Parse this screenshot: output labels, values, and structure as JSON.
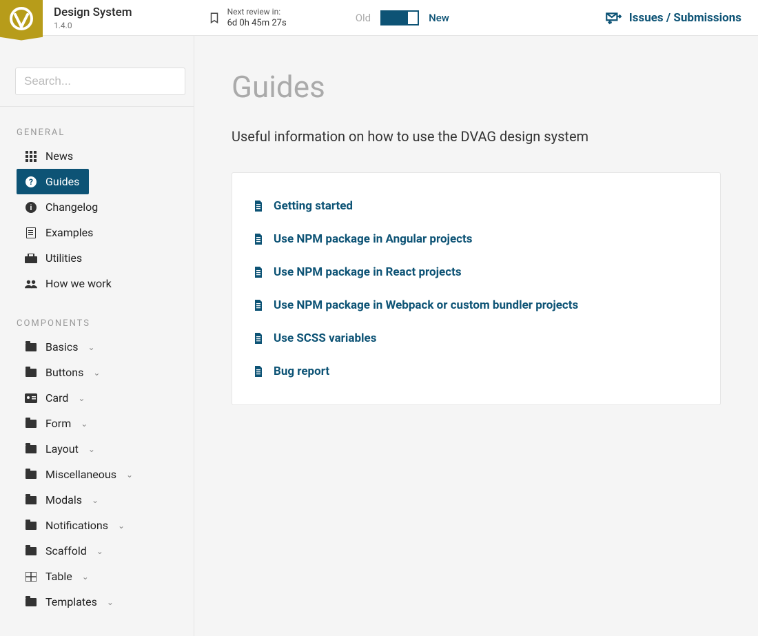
{
  "header": {
    "brand_title": "Design System",
    "brand_version": "1.4.0",
    "review_label": "Next review in:",
    "review_value": "6d   0h   45m   27s",
    "switch_old": "Old",
    "switch_new": "New",
    "issues_label": "Issues / Submissions"
  },
  "search": {
    "placeholder": "Search..."
  },
  "sidebar": {
    "section_general": "GENERAL",
    "section_components": "COMPONENTS",
    "general": [
      {
        "label": "News",
        "icon": "grid"
      },
      {
        "label": "Guides",
        "icon": "question",
        "active": true
      },
      {
        "label": "Changelog",
        "icon": "info"
      },
      {
        "label": "Examples",
        "icon": "doc"
      },
      {
        "label": "Utilities",
        "icon": "tools"
      },
      {
        "label": "How we work",
        "icon": "users"
      }
    ],
    "components": [
      {
        "label": "Basics"
      },
      {
        "label": "Buttons"
      },
      {
        "label": "Card"
      },
      {
        "label": "Form"
      },
      {
        "label": "Layout"
      },
      {
        "label": "Miscellaneous"
      },
      {
        "label": "Modals"
      },
      {
        "label": "Notifications"
      },
      {
        "label": "Scaffold"
      },
      {
        "label": "Table"
      },
      {
        "label": "Templates"
      }
    ]
  },
  "page": {
    "title": "Guides",
    "subtitle": "Useful information on how to use the DVAG design system",
    "links": [
      "Getting started",
      "Use NPM package in Angular projects",
      "Use NPM package in React projects",
      "Use NPM package in Webpack or custom bundler projects",
      "Use SCSS variables",
      "Bug report"
    ]
  }
}
